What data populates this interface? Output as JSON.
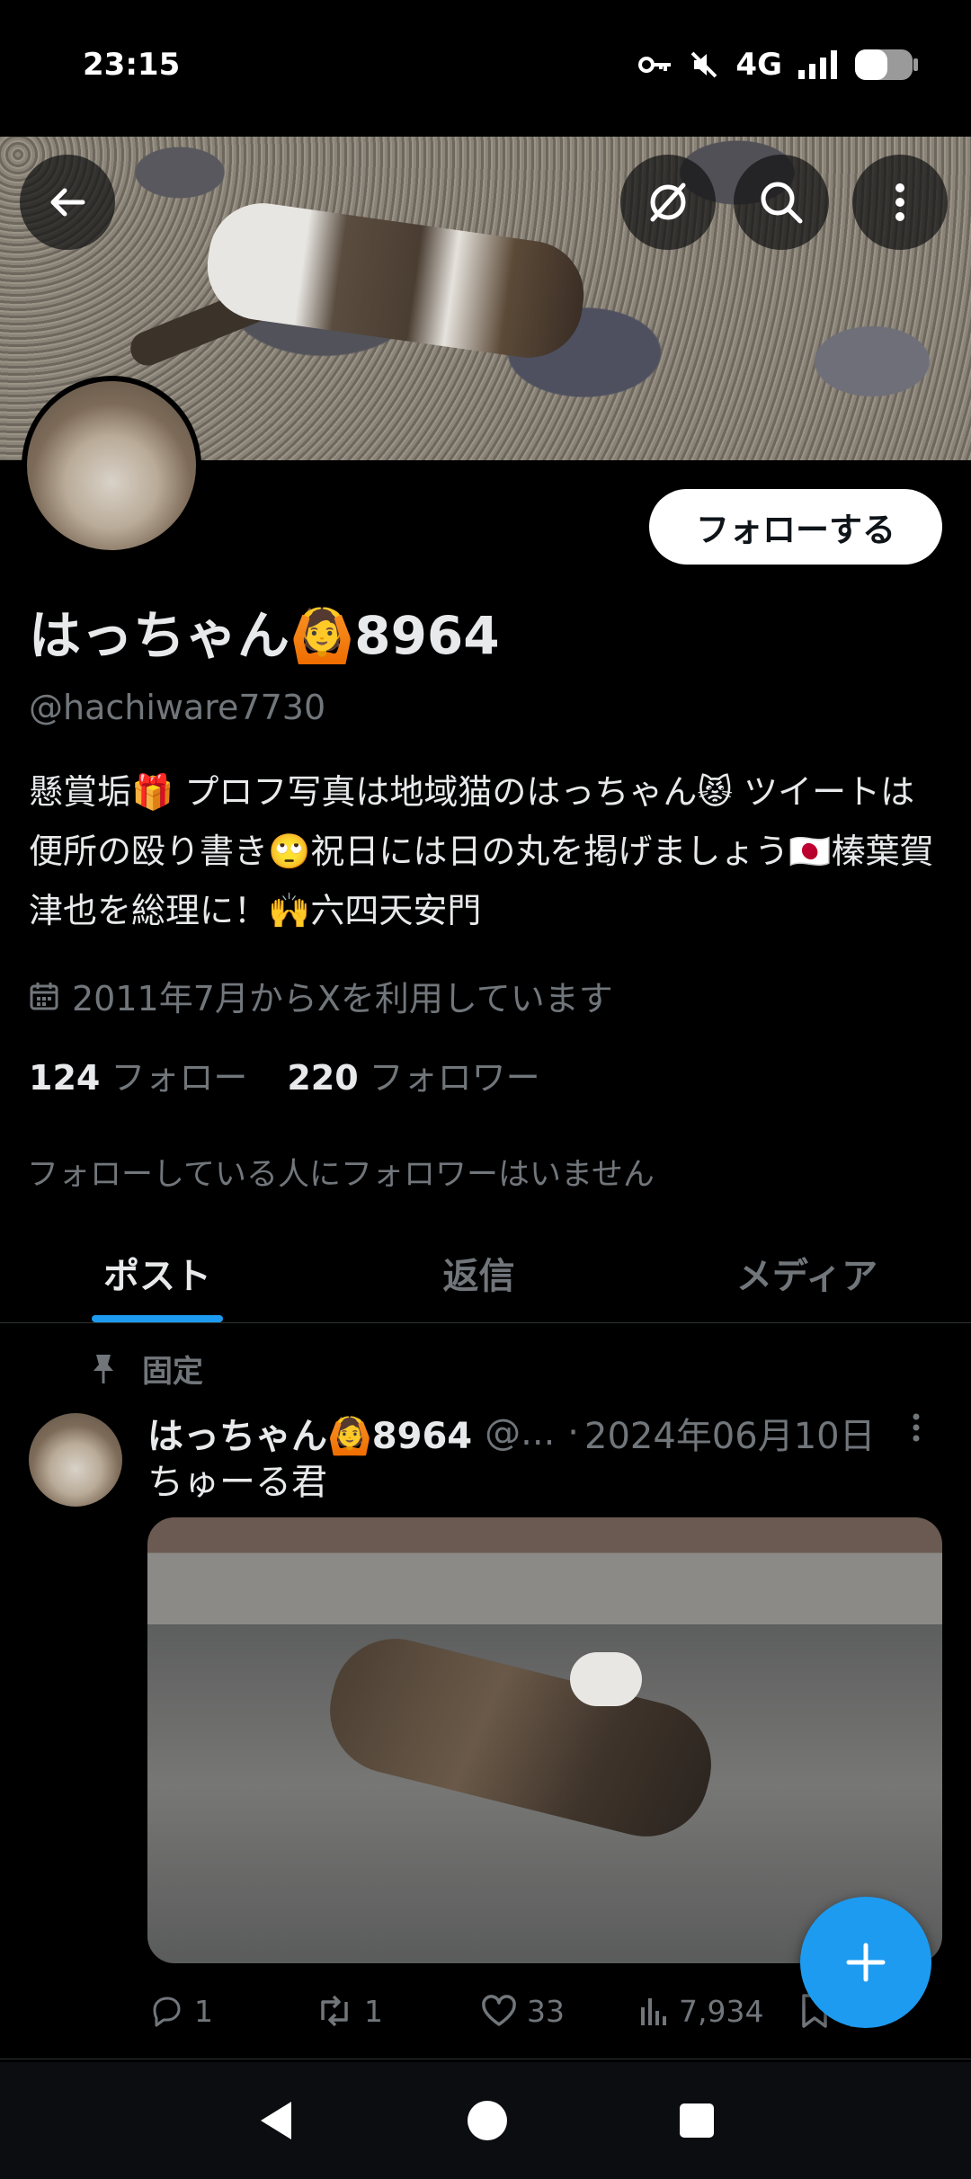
{
  "status": {
    "time": "23:15",
    "network": "4G"
  },
  "profile": {
    "display_name": "はっちゃん🙆8964",
    "handle": "@hachiware7730",
    "follow_label": "フォローする",
    "bio": "懸賞垢🎁 プロフ写真は地域猫のはっちゃん😾 ツイートは便所の殴り書き🙄祝日には日の丸を掲げましょう🇯🇵榛葉賀津也を総理に！🙌六四天安門",
    "joined": "2011年7月からXを利用しています",
    "following_count": "124",
    "following_label": "フォロー",
    "followers_count": "220",
    "followers_label": "フォロワー",
    "no_mutual": "フォローしている人にフォロワーはいません"
  },
  "tabs": [
    {
      "label": "ポスト",
      "active": true
    },
    {
      "label": "返信",
      "active": false
    },
    {
      "label": "メディア",
      "active": false
    }
  ],
  "post": {
    "pinned_label": "固定",
    "author": "はっちゃん🙆8964",
    "handle": "@...",
    "separator": "·",
    "date": "2024年06月10日",
    "text": "ちゅーる君",
    "replies": "1",
    "reposts": "1",
    "likes": "33",
    "views": "7,934"
  },
  "icons": [
    "back-arrow-icon",
    "no-grok-icon",
    "search-icon",
    "more-vertical-icon",
    "calendar-icon",
    "pin-icon",
    "reply-icon",
    "repost-icon",
    "like-icon",
    "views-icon",
    "bookmark-icon",
    "share-icon",
    "plus-icon",
    "nav-back-icon",
    "nav-home-icon",
    "nav-recents-icon"
  ],
  "colors": {
    "accent": "#1d9bf0",
    "background": "#000000",
    "secondary_text": "#71767b"
  }
}
